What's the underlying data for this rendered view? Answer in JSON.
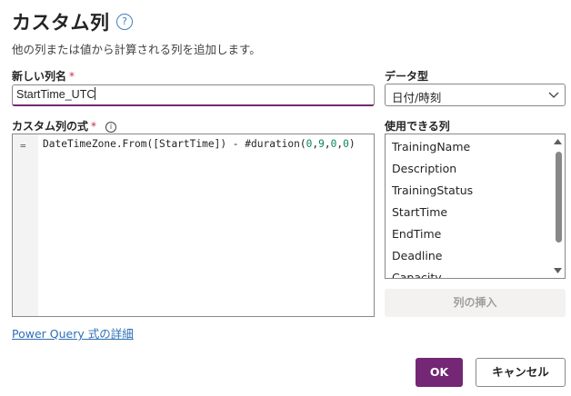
{
  "dialog": {
    "title": "カスタム列",
    "help_icon": "question-circle-icon",
    "subtitle": "他の列または値から計算される列を追加します。"
  },
  "new_column": {
    "label": "新しい列名",
    "required": "*",
    "value": "StartTime_UTC"
  },
  "data_type": {
    "label": "データ型",
    "selected": "日付/時刻",
    "icon": "chevron-down-icon"
  },
  "formula": {
    "label": "カスタム列の式",
    "required": "*",
    "info_icon": "info-icon",
    "gutter": "=",
    "code_before": "DateTimeZone.From([StartTime]) - #duration(",
    "args": [
      "0",
      "9",
      "0",
      "0"
    ],
    "code_after": ")"
  },
  "available_columns": {
    "label": "使用できる列",
    "items": [
      "TrainingName",
      "Description",
      "TrainingStatus",
      "StartTime",
      "EndTime",
      "Deadline",
      "Capacity"
    ]
  },
  "insert_button": "列の挿入",
  "pq_link": "Power Query 式の詳細",
  "ok_button": "OK",
  "cancel_button": "キャンセル",
  "colors": {
    "accent": "#742774",
    "link": "#2e6fb7",
    "required": "#c4314b"
  }
}
